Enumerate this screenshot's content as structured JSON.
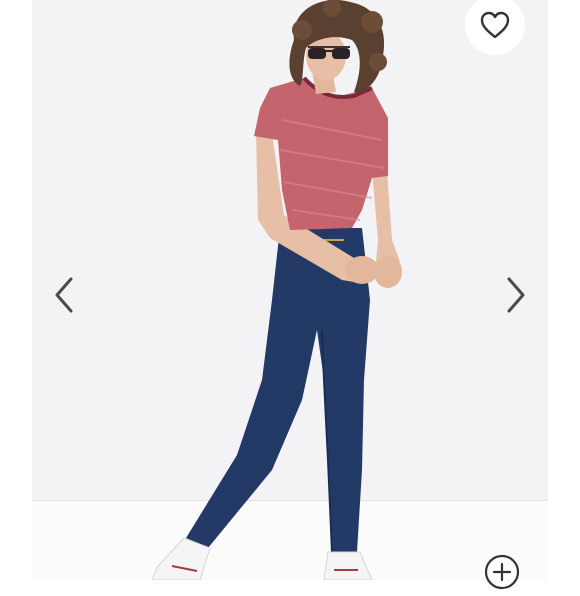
{
  "viewer": {
    "favorite_icon": "heart-outline-icon",
    "prev_icon": "chevron-left-icon",
    "next_icon": "chevron-right-icon",
    "zoom_icon": "zoom-in-plus-icon"
  },
  "product_image": {
    "colors": {
      "background": "#f3f2f4",
      "tshirt": "#c4646c",
      "jeans": "#243a66",
      "hair": "#5a4030",
      "control": "#4a4a4a"
    }
  }
}
